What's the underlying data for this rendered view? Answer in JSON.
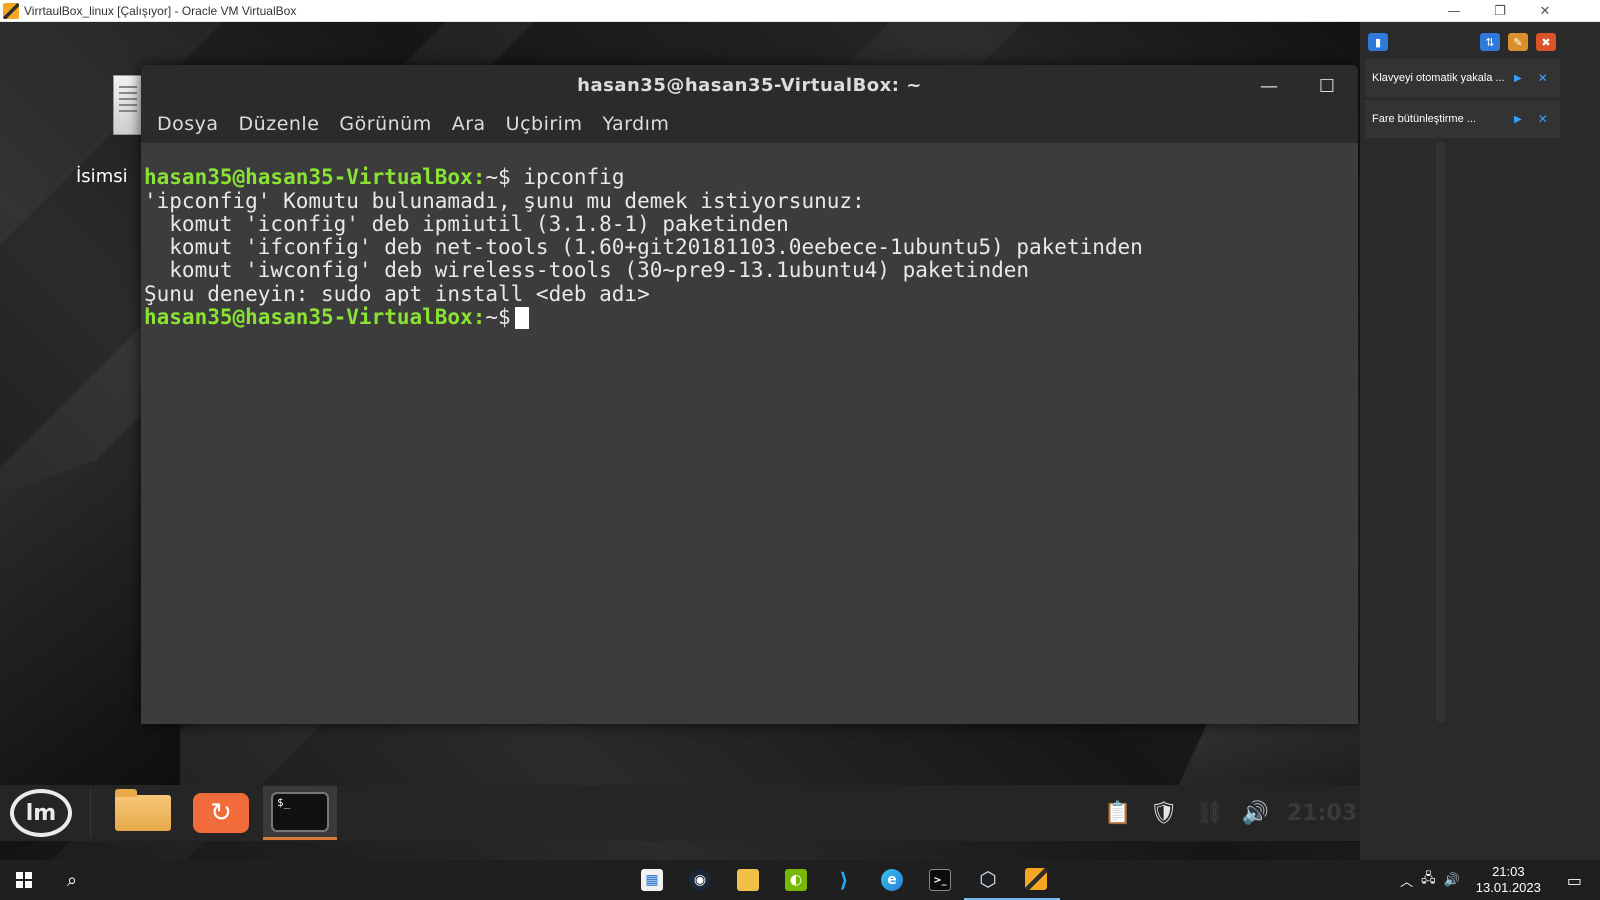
{
  "host": {
    "title": "VirrtaulBox_linux [Çalışıyor] - Oracle VM VirtualBox",
    "controls": {
      "minimize": "—",
      "restore": "❐",
      "close": "✕"
    }
  },
  "desktop": {
    "icon_label": "İsimsi"
  },
  "terminal": {
    "title": "hasan35@hasan35-VirtualBox: ~",
    "menu": [
      "Dosya",
      "Düzenle",
      "Görünüm",
      "Ara",
      "Uçbirim",
      "Yardım"
    ],
    "prompt": "hasan35@hasan35-VirtualBox:",
    "prompt_path": "~$",
    "command": "ipconfig",
    "output": [
      "'ipconfig' Komutu bulunamadı, şunu mu demek istiyorsunuz:",
      "  komut 'iconfig' deb ipmiutil (3.1.8-1) paketinden",
      "  komut 'ifconfig' deb net-tools (1.60+git20181103.0eebece-1ubuntu5) paketinden",
      "  komut 'iwconfig' deb wireless-tools (30~pre9-13.1ubuntu4) paketinden",
      "Şunu deneyin: sudo apt install <deb adı>"
    ]
  },
  "mint_panel": {
    "clock": "21:03",
    "tray_icons": [
      "clipboard-icon",
      "shield-icon",
      "network-icon",
      "volume-icon"
    ]
  },
  "notifications": [
    {
      "text": "Klavyeyi otomatik yakala ..."
    },
    {
      "text": "Fare bütünleştirme ..."
    }
  ],
  "windows_taskbar": {
    "time": "21:03",
    "date": "13.01.2023",
    "apps": [
      "store-icon",
      "steam-icon",
      "file-explorer-icon",
      "nvidia-icon",
      "vscode-icon",
      "edge-icon",
      "terminal-icon",
      "virtualbox-icon",
      "virtualbox-vm-icon"
    ]
  }
}
